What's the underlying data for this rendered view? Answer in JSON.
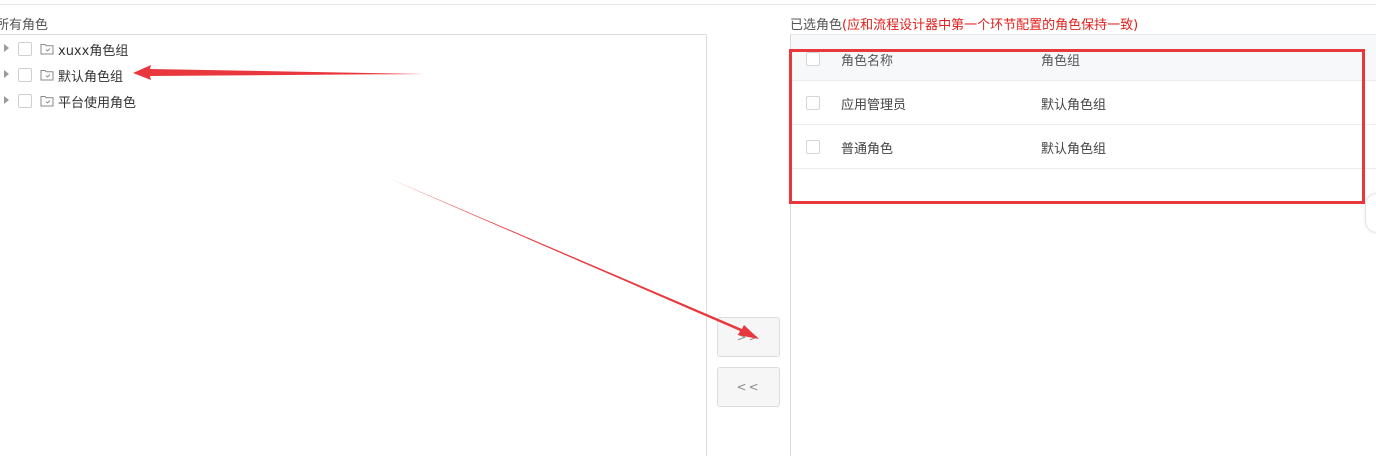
{
  "left_panel": {
    "title": "所有角色",
    "tree_items": [
      {
        "label": "xuxx角色组"
      },
      {
        "label": "默认角色组"
      },
      {
        "label": "平台使用角色"
      }
    ]
  },
  "transfer": {
    "add_label": ">>",
    "remove_label": "<<"
  },
  "right_panel": {
    "title": "已选角色",
    "note": "(应和流程设计器中第一个环节配置的角色保持一致)",
    "columns": [
      "角色名称",
      "角色组"
    ],
    "rows": [
      {
        "name": "应用管理员",
        "group": "默认角色组"
      },
      {
        "name": "普通角色",
        "group": "默认角色组"
      }
    ]
  },
  "colors": {
    "annotation_red": "#e8383d",
    "note_red": "#e0201c",
    "border_gray": "#dcdcdc"
  }
}
